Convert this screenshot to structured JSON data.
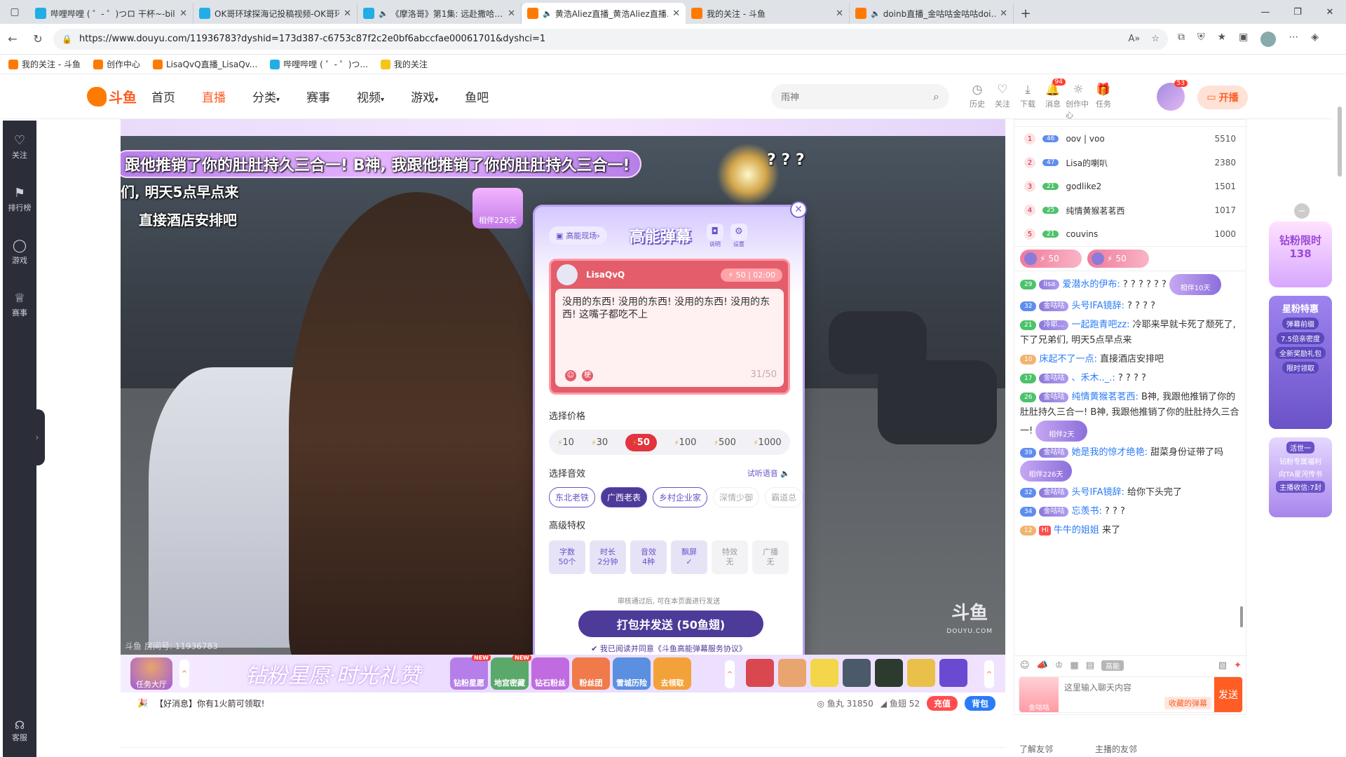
{
  "browser": {
    "tabs": [
      {
        "title": "哔哩哔哩 ( ゜- ゜)つロ 干杯~-bilibili",
        "fav_color": "#23ade5",
        "muted": false,
        "active": false
      },
      {
        "title": "OK哥环球探海记投稿视频-OK哥环…",
        "fav_color": "#23ade5",
        "muted": false,
        "active": false
      },
      {
        "title": "《摩洛哥》第1集: 远赴撒哈…",
        "fav_color": "#23ade5",
        "muted": true,
        "active": false
      },
      {
        "title": "黄浩Aliez直播_黄浩Aliez直播…",
        "fav_color": "#ff7a00",
        "muted": true,
        "active": true
      },
      {
        "title": "我的关注 - 斗鱼",
        "fav_color": "#ff7a00",
        "muted": false,
        "active": false
      },
      {
        "title": "doinb直播_金咕咕金咕咕doi…",
        "fav_color": "#ff7a00",
        "muted": true,
        "active": false
      }
    ],
    "url": "https://www.douyu.com/11936783?dyshid=173d387-c6753c87f2c2e0bf6abccfae00061701&dyshci=1",
    "bookmarks": [
      {
        "label": "我的关注 - 斗鱼",
        "color": "#ff7a00"
      },
      {
        "label": "创作中心",
        "color": "#ff7a00"
      },
      {
        "label": "LisaQvQ直播_LisaQv...",
        "color": "#ff7a00"
      },
      {
        "label": "哔哩哔哩 ( ゜- ゜)つ...",
        "color": "#23ade5"
      },
      {
        "label": "我的关注",
        "color": "#f5c518"
      }
    ]
  },
  "header": {
    "logo_text": "斗鱼",
    "nav": [
      {
        "label": "首页",
        "active": false,
        "caret": false
      },
      {
        "label": "直播",
        "active": true,
        "caret": false
      },
      {
        "label": "分类",
        "active": false,
        "caret": true
      },
      {
        "label": "赛事",
        "active": false,
        "caret": false
      },
      {
        "label": "视频",
        "active": false,
        "caret": true
      },
      {
        "label": "游戏",
        "active": false,
        "caret": true
      },
      {
        "label": "鱼吧",
        "active": false,
        "caret": false
      }
    ],
    "search_placeholder": "雨神",
    "icons": [
      {
        "label": "历史",
        "icon": "clock-icon",
        "badge": ""
      },
      {
        "label": "关注",
        "icon": "heart-icon",
        "badge": ""
      },
      {
        "label": "下载",
        "icon": "download-icon",
        "badge": ""
      },
      {
        "label": "消息",
        "icon": "bell-icon",
        "badge": "94"
      },
      {
        "label": "创作中心",
        "icon": "bulb-icon",
        "badge": ""
      },
      {
        "label": "任务",
        "icon": "gift-icon",
        "badge": ""
      }
    ],
    "avatar_badge": "53",
    "open_live_label": "开播"
  },
  "leftrail": {
    "items": [
      "关注",
      "排行榜",
      "游戏",
      "赛事"
    ],
    "bottom": "客服"
  },
  "video": {
    "room_id": "斗鱼 房间号: 11936783",
    "watermark": "斗鱼",
    "watermark_sub": "DOUYU.COM",
    "danmu": [
      "跟他推销了你的肚肚持久三合一! B神, 我跟他推销了你的肚肚持久三合一!",
      "? ? ?",
      "们, 明天5点早点来",
      "直接酒店安排吧"
    ],
    "companion_badge": "相伴226天"
  },
  "popup": {
    "scene_label": "高能现场",
    "title": "高能弹幕",
    "mini": [
      "说明",
      "设置"
    ],
    "card_user": "LisaQvQ",
    "card_price": "50",
    "card_time": "02:00",
    "card_text": "没用的东西! 没用的东西! 没用的东西! 没用的东西! 这嘴子都吃不上",
    "card_count": "31/50",
    "price_label": "选择价格",
    "prices": [
      {
        "v": "10",
        "sel": false
      },
      {
        "v": "30",
        "sel": false
      },
      {
        "v": "50",
        "sel": true
      },
      {
        "v": "100",
        "sel": false
      },
      {
        "v": "500",
        "sel": false
      },
      {
        "v": "1000",
        "sel": false
      }
    ],
    "sound_label": "选择音效",
    "try_listen": "试听语音",
    "sounds": [
      {
        "v": "东北老铁",
        "sel": false,
        "dim": false
      },
      {
        "v": "广西老表",
        "sel": true,
        "dim": false
      },
      {
        "v": "乡村企业家",
        "sel": false,
        "dim": false
      },
      {
        "v": "深情少御",
        "sel": false,
        "dim": true
      },
      {
        "v": "霸道总",
        "sel": false,
        "dim": true
      }
    ],
    "priv_label": "高级特权",
    "privs": [
      {
        "a": "字数",
        "b": "50个",
        "dim": false
      },
      {
        "a": "时长",
        "b": "2分钟",
        "dim": false
      },
      {
        "a": "音效",
        "b": "4种",
        "dim": false
      },
      {
        "a": "飘屏",
        "b": "✓",
        "dim": false
      },
      {
        "a": "特效",
        "b": "无",
        "dim": true
      },
      {
        "a": "广播",
        "b": "无",
        "dim": true
      }
    ],
    "review": "审核通过后, 可在本页面进行发送",
    "send_label": "打包并发送 (50鱼翅)",
    "agree": "我已阅读并同意《斗鱼高能弹幕服务协议》"
  },
  "giftbar": {
    "task_label": "任务大厅",
    "slogan": "钻粉星愿·时光礼赞",
    "buttons": [
      {
        "label": "钻粉星愿",
        "new": true,
        "color": "#b57ee8"
      },
      {
        "label": "地宫密藏",
        "new": true,
        "color": "#5aa86a"
      },
      {
        "label": "钻石粉丝",
        "new": false,
        "color": "#c06ce0"
      },
      {
        "label": "粉丝团",
        "new": false,
        "color": "#f07a4a"
      },
      {
        "label": "雪城历险",
        "new": false,
        "color": "#5b8fe0"
      },
      {
        "label": "去领取",
        "new": false,
        "color": "#f3a23a"
      }
    ],
    "gift_colors": [
      "#d9484f",
      "#e9a56f",
      "#f3d64a",
      "#4a5a6a",
      "#2d3b2f",
      "#e9c14a",
      "#6a4ad0"
    ],
    "notice": "【好消息】你有1火箭可领取!",
    "fishball_label": "鱼丸",
    "fishball": "31850",
    "fishfin_label": "鱼翅",
    "fishfin": "52",
    "recharge": "充值",
    "bag": "背包"
  },
  "rank": [
    {
      "n": "1",
      "lv": "46",
      "name": "oov | voo",
      "score": "5510",
      "green": false
    },
    {
      "n": "2",
      "lv": "47",
      "name": "Lisa的喇叭",
      "score": "2380",
      "green": false
    },
    {
      "n": "3",
      "lv": "21",
      "name": "godlike2",
      "score": "1501",
      "green": true
    },
    {
      "n": "4",
      "lv": "25",
      "name": "纯情黄猴茗茗西",
      "score": "1017",
      "green": true
    },
    {
      "n": "5",
      "lv": "21",
      "name": "couvins",
      "score": "1000",
      "green": true
    }
  ],
  "tickets": [
    "50",
    "50"
  ],
  "chat": [
    {
      "lv": "29",
      "lvc": "g",
      "fan": "lisa",
      "name": "爱潜水的伊布:",
      "text": "? ? ? ? ? ?",
      "comp": "相伴10天"
    },
    {
      "lv": "32",
      "lvc": "",
      "fan": "金咕咕",
      "name": "头号IFA镜辞:",
      "text": "? ? ? ?",
      "comp": ""
    },
    {
      "lv": "21",
      "lvc": "g",
      "fan": "冷耶…",
      "name": "一起跑青吧zz:",
      "text": "冷耶来早就卡死了颓死了, 下了兄弟们, 明天5点早点来",
      "comp": ""
    },
    {
      "lv": "10",
      "lvc": "o",
      "fan": "",
      "name": "床起不了一点:",
      "text": "直接酒店安排吧",
      "comp": ""
    },
    {
      "lv": "17",
      "lvc": "g",
      "fan": "金咕咕",
      "name": "、禾木.._.:",
      "text": "? ? ? ?",
      "comp": ""
    },
    {
      "lv": "26",
      "lvc": "g",
      "fan": "金咕咕",
      "name": "纯情黄猴茗茗西:",
      "text": "B神, 我跟他推销了你的肚肚持久三合一! B神, 我跟他推销了你的肚肚持久三合一!",
      "comp": "相伴2天"
    },
    {
      "lv": "39",
      "lvc": "",
      "fan": "金咕咕",
      "name": "她是我的惊才绝艳:",
      "text": "甜菜身份证带了吗",
      "comp": "相伴226天"
    },
    {
      "lv": "32",
      "lvc": "",
      "fan": "金咕咕",
      "name": "头号IFA镜辞:",
      "text": "给你下头完了",
      "comp": ""
    },
    {
      "lv": "34",
      "lvc": "",
      "fan": "金咕咕",
      "name": "忘羡书:",
      "text": "? ? ?",
      "comp": ""
    },
    {
      "lv": "12",
      "lvc": "o",
      "fan": "",
      "name": "牛牛的姐姐",
      "text": "来了",
      "comp": "",
      "hi": true
    }
  ],
  "chat_tools": {
    "gaoneng": "高能"
  },
  "chat_input": {
    "placeholder": "这里输入聊天内容",
    "hint": "收藏的弹幕",
    "send": "发送",
    "fan_label": "金咕咕"
  },
  "right_bottom": [
    "了解友邻",
    "主播的友邻"
  ],
  "promos": {
    "p1": "钻粉限时138",
    "p2_title": "星粉特惠",
    "p2_items": [
      "弹幕前缀",
      "7.5倍亲密度",
      "全新奖励礼包",
      "限时领取"
    ],
    "p3_items": [
      "活世一",
      "钻粉专属福利",
      "向TA星河传书",
      "主播收信:7封"
    ]
  }
}
